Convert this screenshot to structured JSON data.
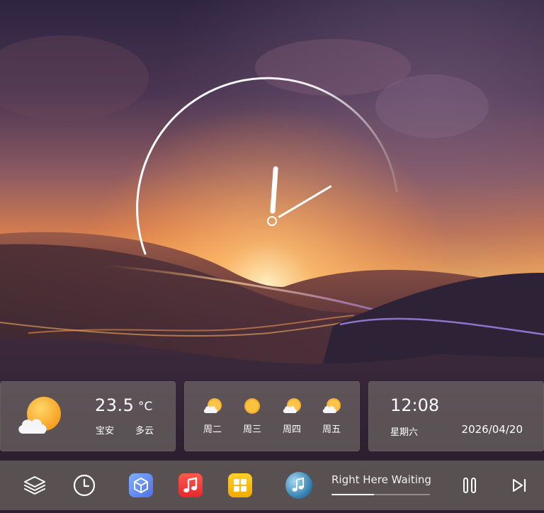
{
  "clock": {
    "hour": 12,
    "minute": 8
  },
  "weather": {
    "icon": "partly-cloudy-icon",
    "temperature": "23.5",
    "unit": "°C",
    "location": "宝安",
    "condition": "多云"
  },
  "forecast": [
    {
      "day": "周二",
      "icon": "partly-cloudy-icon"
    },
    {
      "day": "周三",
      "icon": "sunny-icon"
    },
    {
      "day": "周四",
      "icon": "partly-cloudy-icon"
    },
    {
      "day": "周五",
      "icon": "partly-cloudy-icon"
    }
  ],
  "datetime": {
    "time": "12:08",
    "weekday": "星期六",
    "date": "2026/04/20"
  },
  "dock": {
    "buttons": [
      "layers-icon",
      "clock-icon"
    ],
    "apps": [
      {
        "name": "cube-app-icon",
        "color": "#5b8cf2"
      },
      {
        "name": "music-app-icon",
        "color": "#f2413a"
      },
      {
        "name": "grid-app-icon",
        "color": "#f5b800"
      }
    ],
    "player": {
      "title": "Right Here Waiting",
      "progress": 0.43,
      "controls": [
        "pause-icon",
        "skip-next-icon"
      ]
    }
  }
}
